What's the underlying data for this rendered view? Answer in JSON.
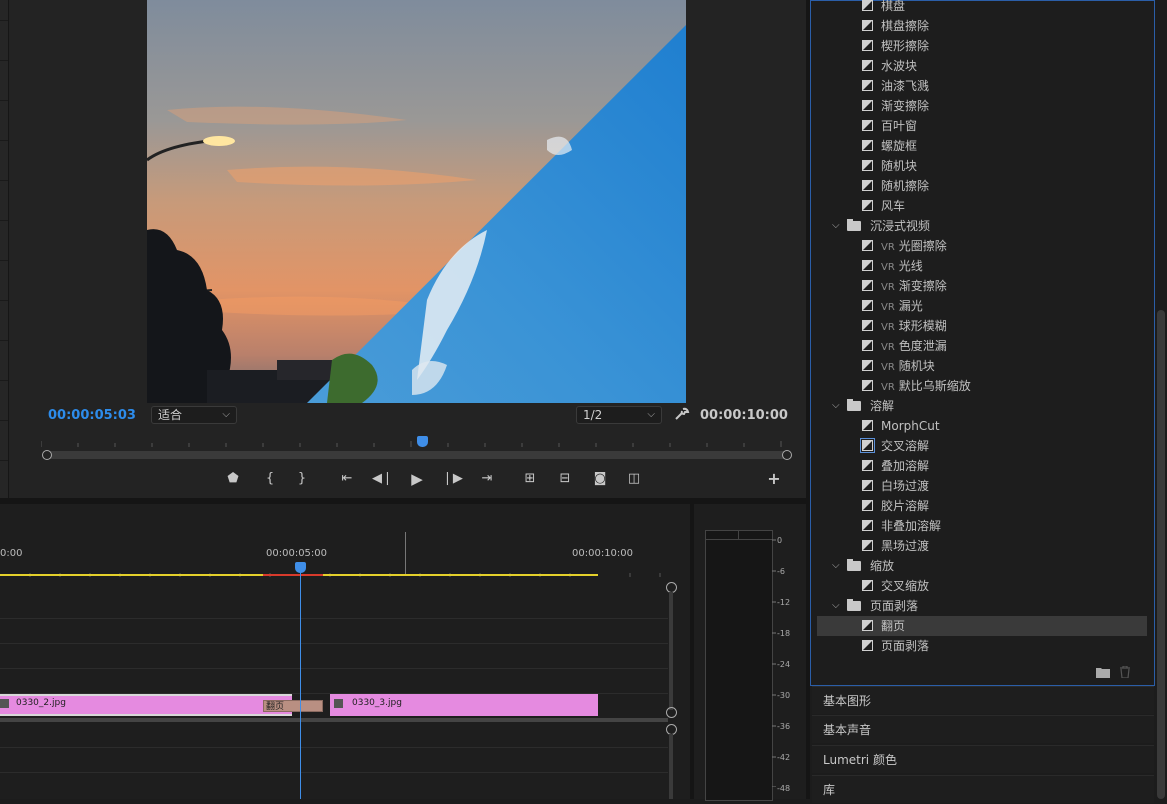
{
  "monitor": {
    "current_time": "00:00:05:03",
    "fit_value": "适合",
    "resolution_value": "1/2",
    "duration": "00:00:10:00"
  },
  "timeline": {
    "ruler_labels": [
      "0:00",
      "00:00:05:00",
      "00:00:10:00"
    ],
    "clips": [
      {
        "name": "0330_2.jpg"
      },
      {
        "name": "0330_3.jpg"
      }
    ],
    "transition_label": "翻页"
  },
  "meter": {
    "scale": [
      "0",
      "-6",
      "-12",
      "-18",
      "-24",
      "-30",
      "-36",
      "-42",
      "-48"
    ]
  },
  "effects": {
    "items": [
      {
        "type": "effect",
        "label": "棋盘"
      },
      {
        "type": "effect",
        "label": "棋盘擦除"
      },
      {
        "type": "effect",
        "label": "楔形擦除"
      },
      {
        "type": "effect",
        "label": "水波块"
      },
      {
        "type": "effect",
        "label": "油漆飞溅"
      },
      {
        "type": "effect",
        "label": "渐变擦除"
      },
      {
        "type": "effect",
        "label": "百叶窗"
      },
      {
        "type": "effect",
        "label": "螺旋框"
      },
      {
        "type": "effect",
        "label": "随机块"
      },
      {
        "type": "effect",
        "label": "随机擦除"
      },
      {
        "type": "effect",
        "label": "风车"
      },
      {
        "type": "folder",
        "label": "沉浸式视频"
      },
      {
        "type": "vr",
        "prefix": "VR",
        "label": "光圈擦除"
      },
      {
        "type": "vr",
        "prefix": "VR",
        "label": "光线"
      },
      {
        "type": "vr",
        "prefix": "VR",
        "label": "渐变擦除"
      },
      {
        "type": "vr",
        "prefix": "VR",
        "label": "漏光"
      },
      {
        "type": "vr",
        "prefix": "VR",
        "label": "球形模糊"
      },
      {
        "type": "vr",
        "prefix": "VR",
        "label": "色度泄漏"
      },
      {
        "type": "vr",
        "prefix": "VR",
        "label": "随机块"
      },
      {
        "type": "vr",
        "prefix": "VR",
        "label": "默比乌斯缩放"
      },
      {
        "type": "folder",
        "label": "溶解"
      },
      {
        "type": "effect",
        "label": "MorphCut"
      },
      {
        "type": "effect",
        "label": "交叉溶解",
        "highlight": true
      },
      {
        "type": "effect",
        "label": "叠加溶解"
      },
      {
        "type": "effect",
        "label": "白场过渡"
      },
      {
        "type": "effect",
        "label": "胶片溶解"
      },
      {
        "type": "effect",
        "label": "非叠加溶解"
      },
      {
        "type": "effect",
        "label": "黑场过渡"
      },
      {
        "type": "folder",
        "label": "缩放"
      },
      {
        "type": "effect",
        "label": "交叉缩放"
      },
      {
        "type": "folder",
        "label": "页面剥落"
      },
      {
        "type": "effect",
        "label": "翻页",
        "selected": true
      },
      {
        "type": "effect",
        "label": "页面剥落"
      }
    ]
  },
  "sections": [
    "基本图形",
    "基本声音",
    "Lumetri 颜色",
    "库"
  ],
  "colors": {
    "accent": "#2b5ea8",
    "timecode": "#2d8ceb",
    "clip": "#e58ae0",
    "playhead": "#3f8ee8"
  }
}
